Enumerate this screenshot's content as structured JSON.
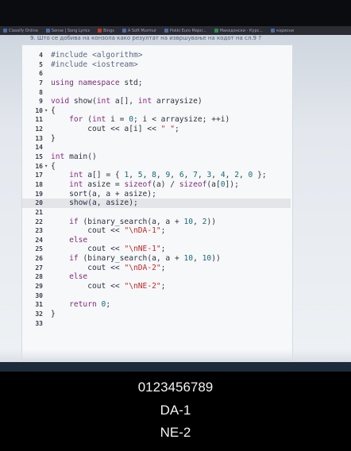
{
  "bookmarks": [
    "Classify Online",
    "Sense | Song Lyrics",
    "Bings",
    "A Soft Murmur",
    "Pokki Euro Major...",
    "Македонски - Курс...",
    "корисни"
  ],
  "question": "9. Што се добива на конзола како резултат на извршување на кодот на сл.9 ?",
  "code_lines": [
    {
      "n": "4",
      "fold": "",
      "html": "<span class='pp'>#include &lt;algorithm&gt;</span>"
    },
    {
      "n": "5",
      "fold": "",
      "html": "<span class='pp'>#include &lt;iostream&gt;</span>"
    },
    {
      "n": "6",
      "fold": "",
      "html": ""
    },
    {
      "n": "7",
      "fold": "",
      "html": "<span class='kw'>using namespace</span> <span class='src'>std;</span>"
    },
    {
      "n": "8",
      "fold": "",
      "html": ""
    },
    {
      "n": "9",
      "fold": "",
      "html": "<span class='ty'>void</span> <span class='src'>show(</span><span class='ty'>int</span> <span class='src'>a[],</span> <span class='ty'>int</span> <span class='src'>arraysize)</span>"
    },
    {
      "n": "10",
      "fold": "▾",
      "html": "<span class='sym'>{</span>"
    },
    {
      "n": "11",
      "fold": "",
      "html": "    <span class='kw'>for</span> <span class='src'>(</span><span class='ty'>int</span> <span class='src'>i = </span><span class='num'>0</span><span class='src'>; i &lt; arraysize; ++i)</span>"
    },
    {
      "n": "12",
      "fold": "",
      "html": "        <span class='src'>cout &lt;&lt; a[i] &lt;&lt; </span><span class='str'>\" \"</span><span class='src'>;</span>"
    },
    {
      "n": "13",
      "fold": "",
      "html": "<span class='sym'>}</span>"
    },
    {
      "n": "14",
      "fold": "",
      "html": ""
    },
    {
      "n": "15",
      "fold": "",
      "html": "<span class='ty'>int</span> <span class='src'>main()</span>"
    },
    {
      "n": "16",
      "fold": "▾",
      "html": "<span class='sym'>{</span>"
    },
    {
      "n": "17",
      "fold": "",
      "html": "    <span class='ty'>int</span> <span class='src'>a[] = { </span><span class='num'>1</span><span class='src'>, </span><span class='num'>5</span><span class='src'>, </span><span class='num'>8</span><span class='src'>, </span><span class='num'>9</span><span class='src'>, </span><span class='num'>6</span><span class='src'>, </span><span class='num'>7</span><span class='src'>, </span><span class='num'>3</span><span class='src'>, </span><span class='num'>4</span><span class='src'>, </span><span class='num'>2</span><span class='src'>, </span><span class='num'>0</span><span class='src'> };</span>"
    },
    {
      "n": "18",
      "fold": "",
      "html": "    <span class='ty'>int</span> <span class='src'>asize = </span><span class='kw'>sizeof</span><span class='src'>(a) / </span><span class='kw'>sizeof</span><span class='src'>(a[</span><span class='num'>0</span><span class='src'>]);</span>"
    },
    {
      "n": "19",
      "fold": "",
      "html": "    <span class='src'>sort(a, a + asize);</span>"
    },
    {
      "n": "20",
      "fold": "",
      "html": "    <span class='src'>show(a, asize);</span>",
      "hl": true
    },
    {
      "n": "21",
      "fold": "",
      "html": ""
    },
    {
      "n": "22",
      "fold": "",
      "html": "    <span class='kw'>if</span> <span class='src'>(binary_search(a, a + </span><span class='num'>10</span><span class='src'>, </span><span class='num'>2</span><span class='src'>))</span>"
    },
    {
      "n": "23",
      "fold": "",
      "html": "        <span class='src'>cout &lt;&lt; </span><span class='str'>\"\\nDA-1\"</span><span class='src'>;</span>"
    },
    {
      "n": "24",
      "fold": "",
      "html": "    <span class='kw'>else</span>"
    },
    {
      "n": "25",
      "fold": "",
      "html": "        <span class='src'>cout &lt;&lt; </span><span class='str'>\"\\nNE-1\"</span><span class='src'>;</span>"
    },
    {
      "n": "26",
      "fold": "",
      "html": "    <span class='kw'>if</span> <span class='src'>(binary_search(a, a + </span><span class='num'>10</span><span class='src'>, </span><span class='num'>10</span><span class='src'>))</span>"
    },
    {
      "n": "27",
      "fold": "",
      "html": "        <span class='src'>cout &lt;&lt; </span><span class='str'>\"\\nDA-2\"</span><span class='src'>;</span>"
    },
    {
      "n": "28",
      "fold": "",
      "html": "    <span class='kw'>else</span>"
    },
    {
      "n": "29",
      "fold": "",
      "html": "        <span class='src'>cout &lt;&lt; </span><span class='str'>\"\\nNE-2\"</span><span class='src'>;</span>"
    },
    {
      "n": "30",
      "fold": "",
      "html": ""
    },
    {
      "n": "31",
      "fold": "",
      "html": "    <span class='kw'>return</span> <span class='num'>0</span><span class='src'>;</span>"
    },
    {
      "n": "32",
      "fold": "",
      "html": "<span class='sym'>}</span>"
    },
    {
      "n": "33",
      "fold": "",
      "html": ""
    }
  ],
  "output": {
    "line1": "0123456789",
    "line2": "DA-1",
    "line3": "NE-2"
  },
  "colors": {
    "editor_bg": "#f7f8f9",
    "keyword": "#7a2e7a",
    "string": "#c0282a",
    "number": "#166a7a",
    "output_bg": "#000000",
    "output_text": "#f2f2f2"
  }
}
